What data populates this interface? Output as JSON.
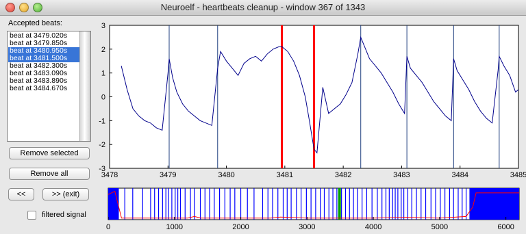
{
  "window": {
    "title": "Neuroelf - heartbeats cleanup - window 367 of 1343"
  },
  "sidebar": {
    "accepted_label": "Accepted beats:",
    "beats": [
      {
        "label": "beat at 3479.020s",
        "selected": false
      },
      {
        "label": "beat at 3479.850s",
        "selected": false
      },
      {
        "label": "beat at 3480.950s",
        "selected": true
      },
      {
        "label": "beat at 3481.500s",
        "selected": true
      },
      {
        "label": "beat at 3482.300s",
        "selected": false
      },
      {
        "label": "beat at 3483.090s",
        "selected": false
      },
      {
        "label": "beat at 3483.890s",
        "selected": false
      },
      {
        "label": "beat at 3484.670s",
        "selected": false
      }
    ],
    "remove_selected_label": "Remove selected",
    "remove_all_label": "Remove all",
    "prev_label": "<<",
    "next_exit_label": ">> (exit)",
    "filtered_signal_label": "filtered signal",
    "filtered_signal_checked": false
  },
  "colors": {
    "signal": "#00008b",
    "beat_marker": "#1f3f7f",
    "selected_beat": "#ff0000",
    "overview_bars": "#0000ff",
    "overview_signal": "#ff0000",
    "current_window": "#00a000"
  },
  "chart_data": [
    {
      "type": "line",
      "title": "",
      "xlabel": "",
      "ylabel": "",
      "xlim": [
        3478,
        3485
      ],
      "ylim": [
        -3,
        3
      ],
      "xticks": [
        "3478",
        "3479",
        "3480",
        "3481",
        "3482",
        "3483",
        "3484",
        "3485"
      ],
      "yticks": [
        "3",
        "2",
        "1",
        "0",
        "-1",
        "-2",
        "-3"
      ],
      "beat_markers": [
        3479.02,
        3479.85,
        3480.95,
        3481.5,
        3482.3,
        3483.09,
        3483.89,
        3484.67
      ],
      "selected_beats": [
        3480.95,
        3481.5
      ],
      "series": [
        {
          "x": [
            3478.2,
            3478.3,
            3478.4,
            3478.5,
            3478.6,
            3478.7,
            3478.8,
            3478.9,
            3479.0,
            3479.02,
            3479.08,
            3479.15,
            3479.25,
            3479.35,
            3479.45,
            3479.55,
            3479.65,
            3479.75,
            3479.85,
            3479.9,
            3480.0,
            3480.1,
            3480.2,
            3480.3,
            3480.4,
            3480.5,
            3480.6,
            3480.7,
            3480.8,
            3480.9,
            3480.95,
            3481.05,
            3481.15,
            3481.25,
            3481.35,
            3481.42,
            3481.5,
            3481.55,
            3481.65,
            3481.75,
            3481.85,
            3481.95,
            3482.05,
            3482.15,
            3482.25,
            3482.3,
            3482.35,
            3482.45,
            3482.55,
            3482.65,
            3482.75,
            3482.85,
            3482.95,
            3483.05,
            3483.09,
            3483.15,
            3483.25,
            3483.35,
            3483.45,
            3483.55,
            3483.65,
            3483.75,
            3483.85,
            3483.89,
            3483.95,
            3484.05,
            3484.15,
            3484.25,
            3484.35,
            3484.45,
            3484.55,
            3484.65,
            3484.67,
            3484.75,
            3484.85,
            3484.95,
            3485.0
          ],
          "y": [
            1.3,
            0.3,
            -0.5,
            -0.8,
            -1.0,
            -1.1,
            -1.3,
            -1.4,
            1.0,
            1.6,
            0.8,
            0.2,
            -0.3,
            -0.6,
            -0.8,
            -1.0,
            -1.1,
            -1.2,
            1.2,
            1.9,
            1.5,
            1.2,
            0.9,
            1.4,
            1.6,
            1.7,
            1.5,
            1.8,
            2.0,
            2.1,
            2.1,
            1.9,
            1.5,
            0.9,
            0.0,
            -1.0,
            -2.2,
            -2.35,
            0.4,
            -0.7,
            -0.5,
            -0.3,
            0.1,
            0.6,
            1.8,
            2.5,
            2.2,
            1.6,
            1.3,
            1.0,
            0.6,
            0.2,
            -0.3,
            -0.7,
            1.7,
            1.2,
            0.9,
            0.6,
            0.2,
            -0.2,
            -0.5,
            -0.8,
            -1.0,
            1.6,
            1.1,
            0.7,
            0.3,
            -0.2,
            -0.6,
            -0.9,
            -1.1,
            1.1,
            1.7,
            1.3,
            0.9,
            0.2,
            0.3
          ]
        }
      ]
    },
    {
      "type": "line",
      "title": "",
      "xlabel": "",
      "ylabel": "",
      "xlim": [
        0,
        6200
      ],
      "xticks": [
        "0",
        "1000",
        "2000",
        "3000",
        "4000",
        "5000",
        "6000"
      ],
      "current_window_x": 3490,
      "beat_lines_x": [
        120,
        250,
        370,
        520,
        640,
        700,
        760,
        820,
        870,
        910,
        960,
        1010,
        1050,
        1090,
        1160,
        1240,
        1300,
        1390,
        1460,
        1530,
        1600,
        1680,
        1760,
        1840,
        1910,
        2000,
        2100,
        2200,
        2330,
        2410,
        2480,
        2560,
        2640,
        2700,
        2760,
        2840,
        2910,
        2990,
        3060,
        3130,
        3200,
        3260,
        3330,
        3390,
        3450,
        3520,
        3580,
        3640,
        3700,
        3760,
        3830,
        3900,
        3980,
        4060,
        4130,
        4190,
        4240,
        4290,
        4330,
        4370,
        4420,
        4460,
        4520,
        4580,
        4650,
        4720,
        4790,
        4870,
        4940,
        5010,
        5080,
        5150,
        5210,
        5280,
        5340,
        5400
      ],
      "solid_blocks": [
        [
          0,
          160
        ],
        [
          5450,
          6200
        ]
      ],
      "series": [
        {
          "x": [
            0,
            100,
            200,
            400,
            800,
            1200,
            1300,
            1400,
            2000,
            2450,
            2600,
            3000,
            3500,
            4000,
            4500,
            5000,
            5400,
            5500,
            5550,
            6200
          ],
          "y": [
            0.8,
            0.9,
            0.05,
            0.05,
            0.05,
            0.05,
            0.1,
            0.05,
            0.05,
            0.05,
            0.08,
            0.05,
            0.05,
            0.05,
            0.07,
            0.05,
            0.1,
            0.4,
            0.85,
            0.85
          ]
        }
      ]
    }
  ]
}
